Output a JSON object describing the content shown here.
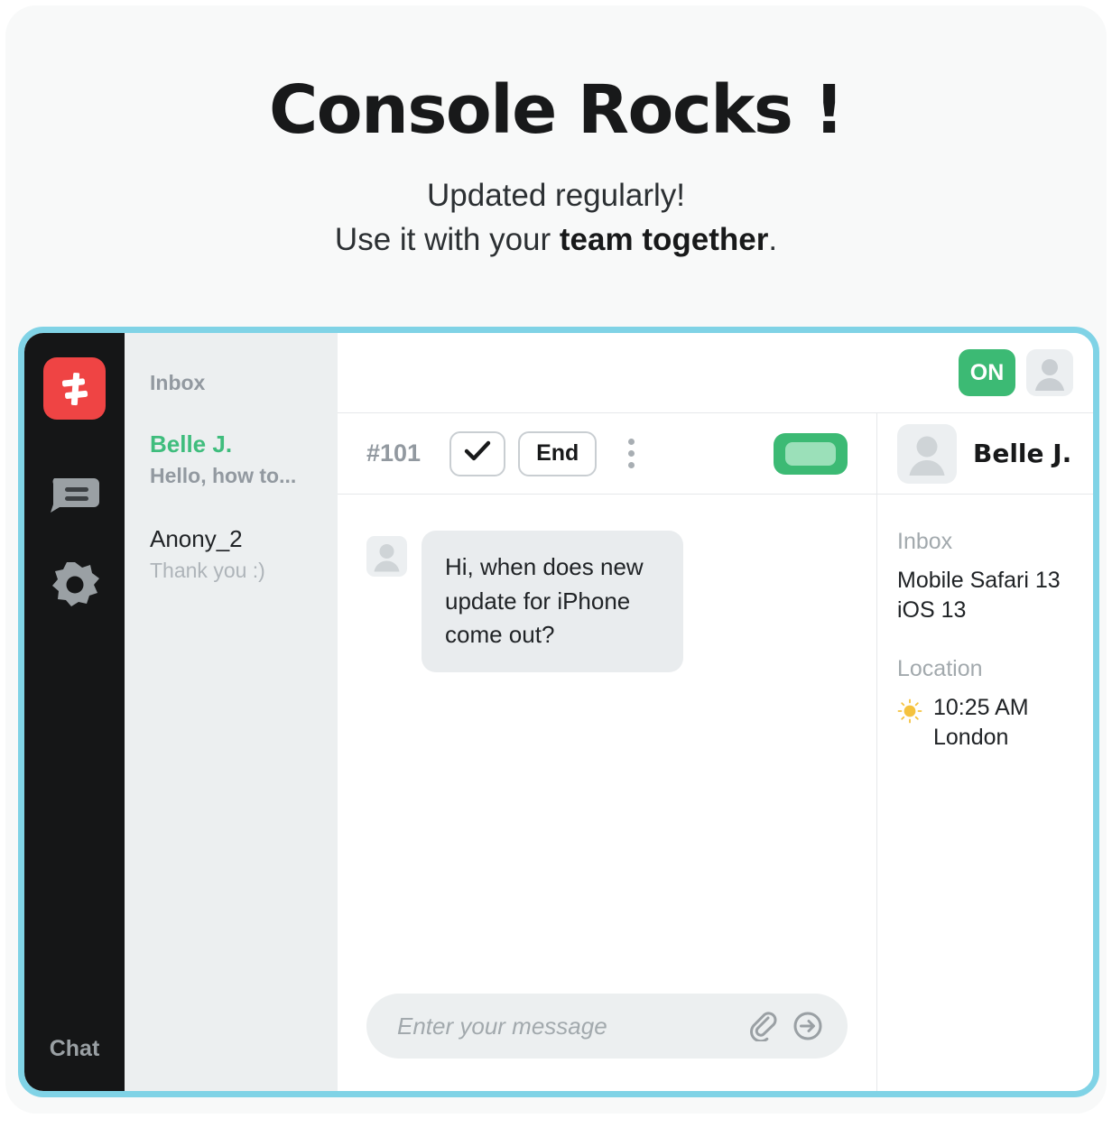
{
  "hero": {
    "title": "Console Rocks !",
    "line1": "Updated regularly!",
    "line2_prefix": "Use it with your ",
    "line2_bold": "team together",
    "line2_suffix": "."
  },
  "colors": {
    "accent_green": "#3cba74",
    "brand_red": "#ef4444",
    "frame_blue": "#80d3e6",
    "rail_dark": "#151617",
    "list_bg": "#eceff0",
    "active_green_text": "#3fbd7d",
    "sun_yellow": "#f5c23e"
  },
  "rail": {
    "logo_icon": "console-logo-icon",
    "chat_icon": "chat-bubble-icon",
    "settings_icon": "gear-icon",
    "label": "Chat"
  },
  "list": {
    "header": "Inbox",
    "conversations": [
      {
        "name": "Belle J.",
        "preview": "Hello, how to...",
        "active": true
      },
      {
        "name": "Anony_2",
        "preview": "Thank you :)",
        "active": false
      }
    ]
  },
  "header": {
    "status_label": "ON",
    "account_avatar_icon": "user-avatar-icon"
  },
  "toolbar": {
    "ticket_id": "#101",
    "resolve_icon": "checkmark-icon",
    "end_label": "End",
    "more_icon": "more-vertical-icon",
    "toggle_icon": "toggle-switch-on"
  },
  "thread": {
    "messages": [
      {
        "avatar_icon": "user-avatar-icon",
        "text": "Hi, when does new update for iPhone come out?"
      }
    ]
  },
  "composer": {
    "value": "",
    "placeholder": "Enter your message",
    "attach_icon": "paperclip-icon",
    "send_icon": "send-arrow-circle-icon"
  },
  "detail": {
    "avatar_icon": "user-avatar-icon",
    "name": "Belle J.",
    "inbox_label": "Inbox",
    "inbox_value_line1": "Mobile Safari 13",
    "inbox_value_line2": "iOS 13",
    "location_label": "Location",
    "weather_icon": "sun-icon",
    "location_time": "10:25 AM",
    "location_city": "London"
  }
}
